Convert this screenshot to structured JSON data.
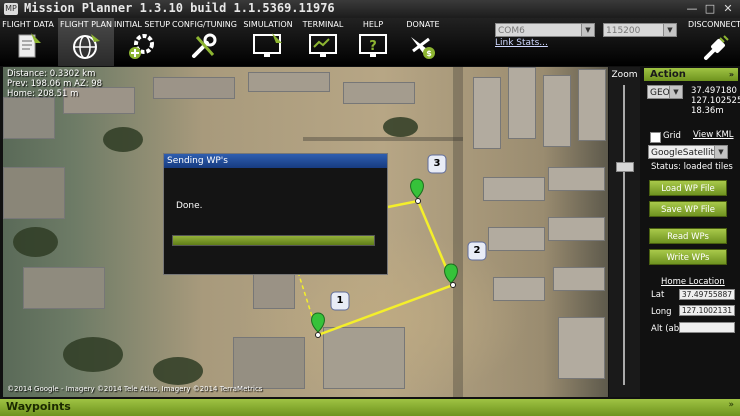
{
  "window": {
    "title": "Mission Planner 1.3.10 build 1.1.5369.11976",
    "minimize_label": "—",
    "maximize_label": "□",
    "close_label": "✕"
  },
  "menu": {
    "items": [
      {
        "label": "FLIGHT DATA",
        "icon": "flight-data-icon"
      },
      {
        "label": "FLIGHT PLAN",
        "icon": "flight-plan-globe-icon",
        "active": true
      },
      {
        "label": "INITIAL SETUP",
        "icon": "initial-setup-gear-icon"
      },
      {
        "label": "CONFIG/TUNING",
        "icon": "config-wrench-icon"
      },
      {
        "label": "SIMULATION",
        "icon": "simulation-monitor-icon"
      },
      {
        "label": "TERMINAL",
        "icon": "terminal-monitor-icon"
      },
      {
        "label": "HELP",
        "icon": "help-monitor-icon"
      },
      {
        "label": "DONATE",
        "icon": "donate-plane-icon"
      }
    ],
    "port_value": "COM6",
    "baud_value": "115200",
    "link_stats": "Link Stats...",
    "disconnect_label": "DISCONNECT"
  },
  "map": {
    "distance": "Distance: 0.3302 km",
    "prev": "Prev: 198.06 m AZ: 98",
    "home": "Home: 208.51 m",
    "copyright": "©2014 Google - Imagery ©2014 Tele Atlas, Imagery ©2014 TerraMetrics",
    "waypoints": [
      {
        "label": "1"
      },
      {
        "label": "2"
      },
      {
        "label": "3"
      }
    ]
  },
  "dialog": {
    "title": "Sending WP's",
    "message": "Done.",
    "progress": 1.0
  },
  "zoom": {
    "label": "Zoom",
    "level": 0.27
  },
  "action": {
    "header": "Action",
    "coord_mode": "GEO",
    "lat": "37.497180",
    "lng": "127.102525",
    "alt": "18.36m",
    "grid_label": "Grid",
    "view_kml": "View KML",
    "map_provider": "GoogleSatelliteM",
    "status": "Status: loaded tiles",
    "load_wp": "Load WP File",
    "save_wp": "Save WP File",
    "read_wps": "Read WPs",
    "write_wps": "Write WPs",
    "home_location": "Home Location",
    "lat_label": "Lat",
    "lat_value": "37.49755887",
    "long_label": "Long",
    "long_value": "127.1002131",
    "alt_label": "Alt (abs)",
    "alt_value": ""
  },
  "bottom": {
    "label": "Waypoints"
  },
  "colors": {
    "accent": "#8db531",
    "route": "#f4ef2a",
    "marker": "#36c23a"
  }
}
